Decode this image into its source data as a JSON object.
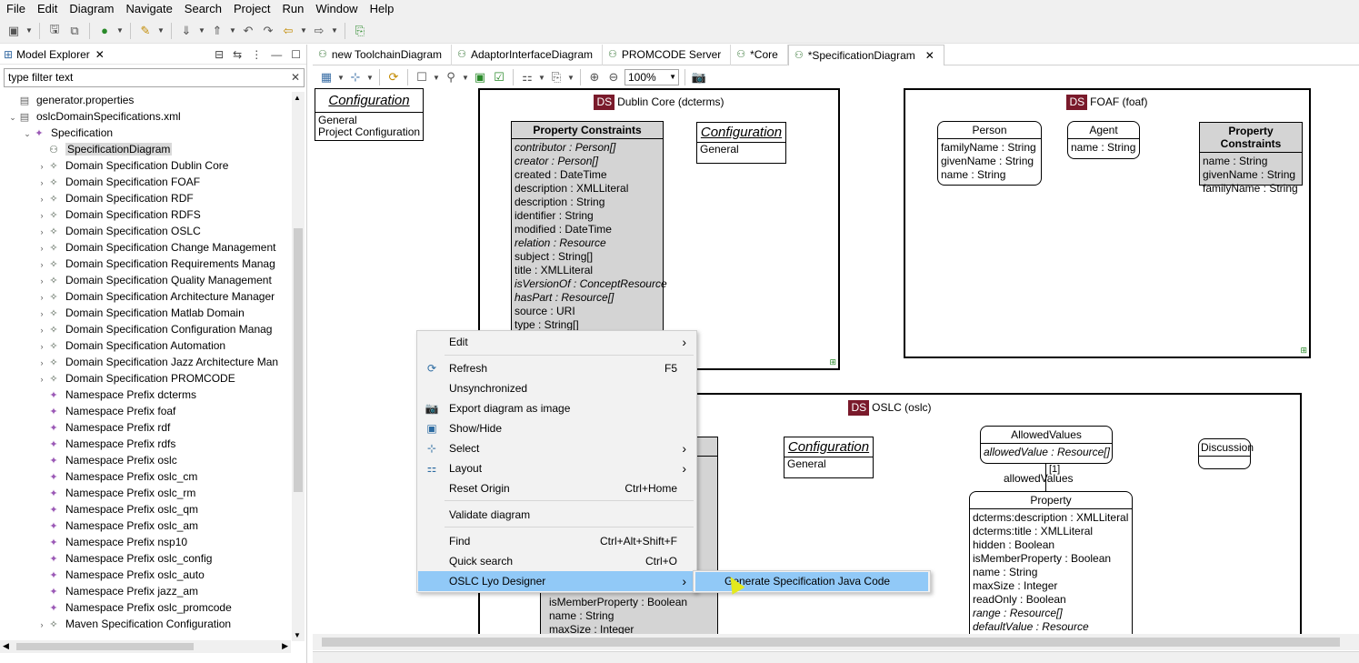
{
  "menubar": [
    "File",
    "Edit",
    "Diagram",
    "Navigate",
    "Search",
    "Project",
    "Run",
    "Window",
    "Help"
  ],
  "explorer": {
    "title": "Model Explorer",
    "filter_placeholder": "type filter text",
    "items": [
      {
        "label": "generator.properties",
        "icon": "file-icon",
        "indent": 1,
        "twisty": ""
      },
      {
        "label": "oslcDomainSpecifications.xml",
        "icon": "xml-file-icon",
        "indent": 1,
        "twisty": "v"
      },
      {
        "label": "Specification",
        "icon": "specification-icon",
        "indent": 2,
        "twisty": "v"
      },
      {
        "label": "SpecificationDiagram",
        "icon": "diagram-icon",
        "indent": 3,
        "twisty": "",
        "selected": true
      },
      {
        "label": "Domain Specification Dublin Core",
        "icon": "domain-icon",
        "indent": 3,
        "twisty": ">"
      },
      {
        "label": "Domain Specification FOAF",
        "icon": "domain-icon",
        "indent": 3,
        "twisty": ">"
      },
      {
        "label": "Domain Specification RDF",
        "icon": "domain-icon",
        "indent": 3,
        "twisty": ">"
      },
      {
        "label": "Domain Specification RDFS",
        "icon": "domain-icon",
        "indent": 3,
        "twisty": ">"
      },
      {
        "label": "Domain Specification OSLC",
        "icon": "domain-icon",
        "indent": 3,
        "twisty": ">"
      },
      {
        "label": "Domain Specification Change Management",
        "icon": "domain-icon",
        "indent": 3,
        "twisty": ">"
      },
      {
        "label": "Domain Specification Requirements Manag",
        "icon": "domain-icon",
        "indent": 3,
        "twisty": ">"
      },
      {
        "label": "Domain Specification Quality Management",
        "icon": "domain-icon",
        "indent": 3,
        "twisty": ">"
      },
      {
        "label": "Domain Specification Architecture Manager",
        "icon": "domain-icon",
        "indent": 3,
        "twisty": ">"
      },
      {
        "label": "Domain Specification Matlab Domain",
        "icon": "domain-icon",
        "indent": 3,
        "twisty": ">"
      },
      {
        "label": "Domain Specification Configuration Manag",
        "icon": "domain-icon",
        "indent": 3,
        "twisty": ">"
      },
      {
        "label": "Domain Specification Automation",
        "icon": "domain-icon",
        "indent": 3,
        "twisty": ">"
      },
      {
        "label": "Domain Specification Jazz Architecture Man",
        "icon": "domain-icon",
        "indent": 3,
        "twisty": ">"
      },
      {
        "label": "Domain Specification PROMCODE",
        "icon": "domain-icon",
        "indent": 3,
        "twisty": ">"
      },
      {
        "label": "Namespace Prefix dcterms",
        "icon": "namespace-icon",
        "indent": 3,
        "twisty": ""
      },
      {
        "label": "Namespace Prefix foaf",
        "icon": "namespace-icon",
        "indent": 3,
        "twisty": ""
      },
      {
        "label": "Namespace Prefix rdf",
        "icon": "namespace-icon",
        "indent": 3,
        "twisty": ""
      },
      {
        "label": "Namespace Prefix rdfs",
        "icon": "namespace-icon",
        "indent": 3,
        "twisty": ""
      },
      {
        "label": "Namespace Prefix oslc",
        "icon": "namespace-icon",
        "indent": 3,
        "twisty": ""
      },
      {
        "label": "Namespace Prefix oslc_cm",
        "icon": "namespace-icon",
        "indent": 3,
        "twisty": ""
      },
      {
        "label": "Namespace Prefix oslc_rm",
        "icon": "namespace-icon",
        "indent": 3,
        "twisty": ""
      },
      {
        "label": "Namespace Prefix oslc_qm",
        "icon": "namespace-icon",
        "indent": 3,
        "twisty": ""
      },
      {
        "label": "Namespace Prefix oslc_am",
        "icon": "namespace-icon",
        "indent": 3,
        "twisty": ""
      },
      {
        "label": "Namespace Prefix nsp10",
        "icon": "namespace-icon",
        "indent": 3,
        "twisty": ""
      },
      {
        "label": "Namespace Prefix oslc_config",
        "icon": "namespace-icon",
        "indent": 3,
        "twisty": ""
      },
      {
        "label": "Namespace Prefix oslc_auto",
        "icon": "namespace-icon",
        "indent": 3,
        "twisty": ""
      },
      {
        "label": "Namespace Prefix jazz_am",
        "icon": "namespace-icon",
        "indent": 3,
        "twisty": ""
      },
      {
        "label": "Namespace Prefix oslc_promcode",
        "icon": "namespace-icon",
        "indent": 3,
        "twisty": ""
      },
      {
        "label": "Maven Specification Configuration",
        "icon": "domain-icon",
        "indent": 3,
        "twisty": ">"
      }
    ]
  },
  "tabs": [
    {
      "label": "new ToolchainDiagram",
      "active": false
    },
    {
      "label": "AdaptorInterfaceDiagram",
      "active": false
    },
    {
      "label": "PROMCODE Server",
      "active": false
    },
    {
      "label": "*Core",
      "active": false
    },
    {
      "label": "*SpecificationDiagram",
      "active": true
    }
  ],
  "zoom": "100%",
  "diagram": {
    "config_top": {
      "title": "Configuration",
      "rows": [
        "General",
        "Project Configuration"
      ]
    },
    "dublin": {
      "badge": "DS",
      "title": "Dublin Core (dcterms)",
      "constraints_title": "Property Constraints",
      "constraints": [
        {
          "t": "contributor : Person[]",
          "i": true
        },
        {
          "t": "creator : Person[]",
          "i": true
        },
        {
          "t": "created : DateTime",
          "i": false
        },
        {
          "t": "description : XMLLiteral",
          "i": false
        },
        {
          "t": "description : String",
          "i": false
        },
        {
          "t": "identifier : String",
          "i": false
        },
        {
          "t": "modified : DateTime",
          "i": false
        },
        {
          "t": "relation : Resource",
          "i": true
        },
        {
          "t": "subject : String[]",
          "i": false
        },
        {
          "t": "title : XMLLiteral",
          "i": false
        },
        {
          "t": "isVersionOf : ConceptResource",
          "i": true
        },
        {
          "t": "hasPart : Resource[]",
          "i": true
        },
        {
          "t": "source : URI",
          "i": false
        },
        {
          "t": "type : String[]",
          "i": false
        }
      ],
      "config": {
        "title": "Configuration",
        "rows": [
          "General"
        ]
      }
    },
    "foaf": {
      "badge": "DS",
      "title": "FOAF (foaf)",
      "person": {
        "title": "Person",
        "rows": [
          "familyName : String",
          "givenName : String",
          "name : String"
        ]
      },
      "agent": {
        "title": "Agent",
        "rows": [
          "name : String"
        ]
      },
      "constraints": {
        "title": "Property Constraints",
        "rows": [
          "name : String",
          "givenName : String",
          "familyName : String"
        ]
      }
    },
    "oslc": {
      "badge": "DS",
      "title": "OSLC (oslc)",
      "config": {
        "title": "Configuration",
        "rows": [
          "General"
        ]
      },
      "allowed": {
        "title": "AllowedValues",
        "rows": [
          "allowedValue : Resource[]"
        ]
      },
      "discussion": {
        "title": "Discussion"
      },
      "assoc_mult": "[1]",
      "assoc_label": "allowedValues",
      "property": {
        "title": "Property",
        "rows": [
          {
            "t": "dcterms:description : XMLLiteral",
            "i": false
          },
          {
            "t": "dcterms:title : XMLLiteral",
            "i": false
          },
          {
            "t": "hidden : Boolean",
            "i": false
          },
          {
            "t": "isMemberProperty : Boolean",
            "i": false
          },
          {
            "t": "name : String",
            "i": false
          },
          {
            "t": "maxSize : Integer",
            "i": false
          },
          {
            "t": "readOnly : Boolean",
            "i": false
          },
          {
            "t": "range : Resource[]",
            "i": true
          },
          {
            "t": "defaultValue : Resource",
            "i": true
          }
        ]
      },
      "grey_rows": [
        "isMemberProperty : Boolean",
        "name : String",
        "maxSize : Integer"
      ]
    }
  },
  "context_menu": {
    "items": [
      {
        "label": "Edit",
        "shortcut": "",
        "arrow": true,
        "icon": ""
      },
      {
        "label": "Refresh",
        "shortcut": "F5",
        "arrow": false,
        "icon": "refresh-icon"
      },
      {
        "label": "Unsynchronized",
        "shortcut": "",
        "arrow": false,
        "icon": ""
      },
      {
        "label": "Export diagram as image",
        "shortcut": "",
        "arrow": false,
        "icon": "camera-icon"
      },
      {
        "label": "Show/Hide",
        "shortcut": "",
        "arrow": false,
        "icon": "show-hide-icon"
      },
      {
        "label": "Select",
        "shortcut": "",
        "arrow": true,
        "icon": "select-icon"
      },
      {
        "label": "Layout",
        "shortcut": "",
        "arrow": true,
        "icon": "layout-icon"
      },
      {
        "label": "Reset Origin",
        "shortcut": "Ctrl+Home",
        "arrow": false,
        "icon": ""
      },
      {
        "label": "Validate diagram",
        "shortcut": "",
        "arrow": false,
        "icon": ""
      },
      {
        "label": "Find",
        "shortcut": "Ctrl+Alt+Shift+F",
        "arrow": false,
        "icon": ""
      },
      {
        "label": "Quick search",
        "shortcut": "Ctrl+O",
        "arrow": false,
        "icon": ""
      },
      {
        "label": "OSLC Lyo Designer",
        "shortcut": "",
        "arrow": true,
        "icon": "",
        "highlighted": true
      }
    ],
    "submenu_item": "Generate Specification Java Code"
  }
}
